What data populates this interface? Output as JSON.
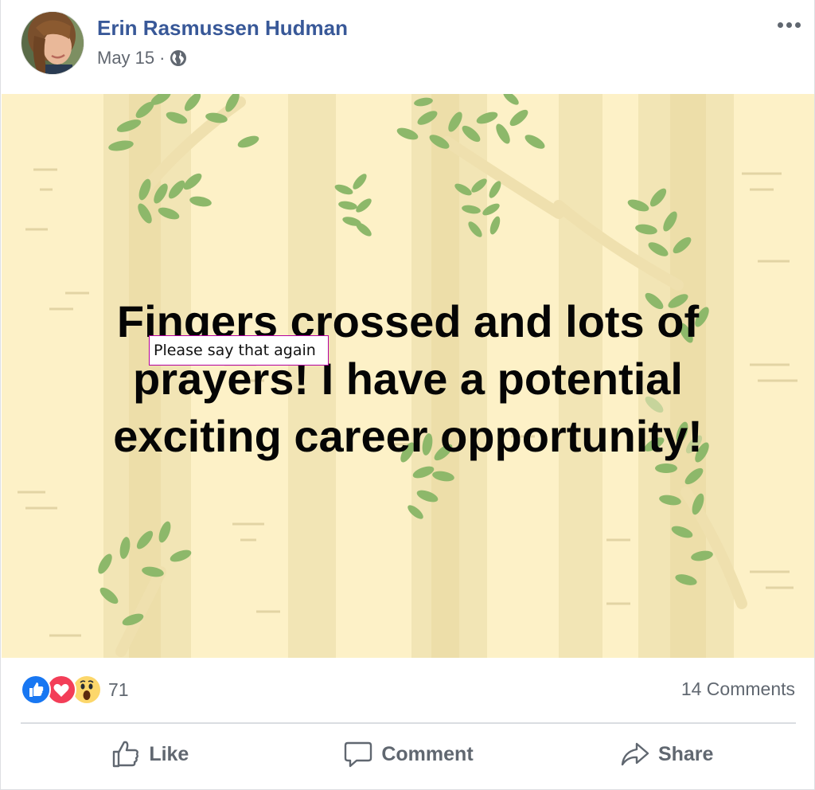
{
  "post": {
    "author": "Erin Rasmussen Hudman",
    "date": "May 15",
    "separator": "·",
    "privacy_icon": "globe-icon",
    "more_icon": "ellipsis-icon",
    "text": "Fingers crossed and lots of prayers! I have a potential exciting career opportunity!",
    "background_color": "#fdf1c7"
  },
  "tooltip": {
    "text": "Please say that again"
  },
  "reactions": {
    "icons": [
      "like-reaction-icon",
      "love-reaction-icon",
      "wow-reaction-icon"
    ],
    "count": "71",
    "comments": "14 Comments"
  },
  "actions": {
    "like": "Like",
    "comment": "Comment",
    "share": "Share"
  },
  "colors": {
    "author": "#385898",
    "meta": "#606770",
    "like_blue": "#1877f2",
    "love_red": "#f33e58",
    "wow_yellow": "#fcd76b"
  }
}
